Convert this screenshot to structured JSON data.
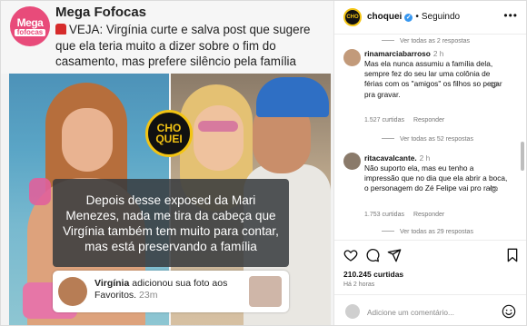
{
  "post": {
    "brand_logo": {
      "line1": "Mega",
      "line2": "fofocas"
    },
    "brand_name": "Mega Fofocas",
    "headline": "VEJA: Virgínia curte e salva post que sugere que ela teria muito a dizer sobre o fim do casamento, mas prefere silêncio pela família",
    "headline_icon": "siren-icon",
    "overlay_logo": {
      "line1": "CHO",
      "line2": "QUEI"
    },
    "overlay_text": "Depois desse exposed da Mari Menezes, nada me tira da cabeça que Virgínia também tem muito para contar, mas está preservando a família",
    "notification": {
      "user": "Virgínia",
      "text": "adicionou sua foto aos Favoritos.",
      "time": "23m"
    }
  },
  "account": {
    "avatar_label": "CHO",
    "name": "choquei",
    "separator": "•",
    "follow_status": "Seguindo",
    "more_label": "•••"
  },
  "comments": {
    "top_view_more": "Ver todas as 2 respostas",
    "items": [
      {
        "user": "rinamarciabarroso",
        "time": "2 h",
        "text": "Mas ela nunca assumiu a família dela, sempre fez do seu lar uma colônia de férias com os \"amigos\" os filhos so pegar pra gravar.",
        "likes": "1.527 curtidas",
        "reply": "Responder",
        "view_replies": "Ver todas as 52 respostas",
        "avatar_color": "#c29a7a"
      },
      {
        "user": "ritacavalcante.",
        "time": "2 h",
        "text": "Não suporto ela, mas eu tenho a impressão que no dia que ela abrir a boca, o personagem do Zé Felipe vai pro ralo.",
        "likes": "1.753 curtidas",
        "reply": "Responder",
        "view_replies": "Ver todas as 29 respostas",
        "avatar_color": "#8a7a6a"
      }
    ]
  },
  "actions": {
    "icons": [
      "heart-icon",
      "comment-icon",
      "share-icon",
      "bookmark-icon"
    ],
    "likes": "210.245 curtidas",
    "time_ago": "Há 2 horas"
  },
  "add_comment": {
    "placeholder": "Adicione um comentário...",
    "emoji_icon": "emoji-icon"
  },
  "colors": {
    "brand_pink": "#e84b7a",
    "choquei_yellow": "#f3c413",
    "verified_blue": "#3797f0",
    "overlay_gray": "#373a3e"
  }
}
